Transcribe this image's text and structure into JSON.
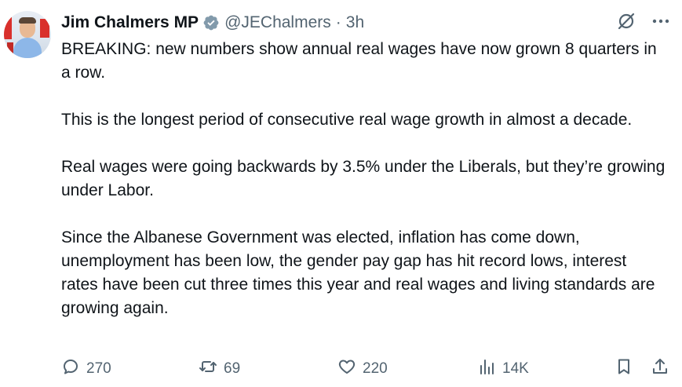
{
  "author": {
    "name": "Jim Chalmers MP",
    "handle": "@JEChalmers",
    "separator": "·",
    "time": "3h"
  },
  "post": {
    "paragraphs": [
      "BREAKING: new numbers show annual real wages have now grown 8 quarters in a row.",
      "This is the longest period of consecutive real wage growth in almost a decade.",
      "Real wages were going backwards by 3.5% under the Liberals, but they’re growing under Labor.",
      "Since the Albanese Government was elected, inflation has come down, unemployment has been low, the gender pay gap has hit record lows, interest rates have been cut three times this year and real wages and living standards are growing again."
    ]
  },
  "actions": {
    "replies": "270",
    "reposts": "69",
    "likes": "220",
    "views": "14K"
  },
  "icons": {
    "verified": "verified-badge-icon",
    "grok": "grok-icon",
    "more": "more-icon",
    "reply": "reply-icon",
    "repost": "repost-icon",
    "like": "like-icon",
    "views": "views-icon",
    "bookmark": "bookmark-icon",
    "share": "share-icon"
  },
  "colors": {
    "text": "#0f1419",
    "muted": "#536471",
    "verified": "#1d9bf0"
  }
}
